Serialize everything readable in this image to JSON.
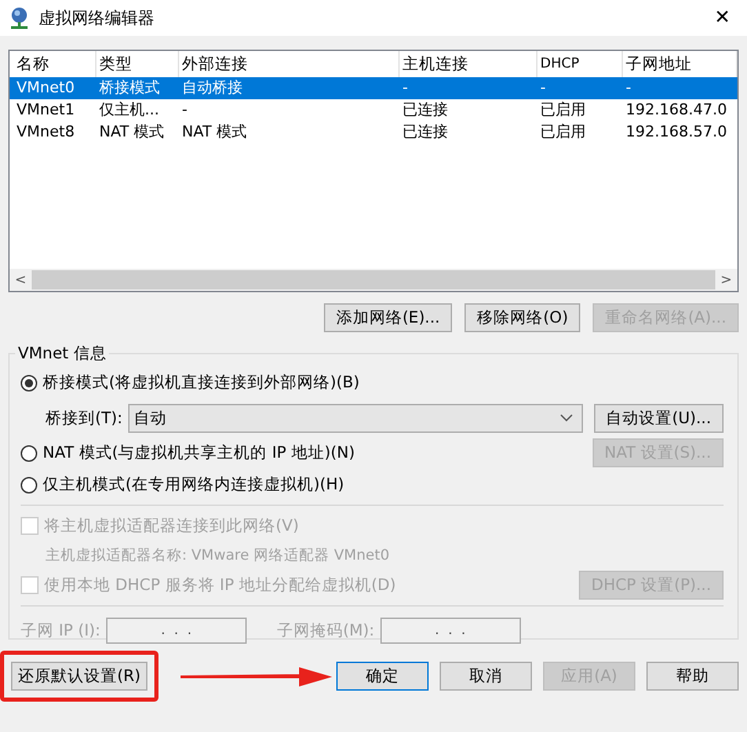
{
  "window": {
    "title": "虚拟网络编辑器",
    "close": "✕"
  },
  "table": {
    "columns": [
      "名称",
      "类型",
      "外部连接",
      "主机连接",
      "DHCP",
      "子网地址"
    ],
    "rows": [
      {
        "cells": [
          "VMnet0",
          "桥接模式",
          "自动桥接",
          "-",
          "-",
          "-"
        ],
        "selected": true
      },
      {
        "cells": [
          "VMnet1",
          "仅主机...",
          "-",
          "已连接",
          "已启用",
          "192.168.47.0"
        ],
        "selected": false
      },
      {
        "cells": [
          "VMnet8",
          "NAT 模式",
          "NAT 模式",
          "已连接",
          "已启用",
          "192.168.57.0"
        ],
        "selected": false
      }
    ],
    "scroll_left": "<",
    "scroll_right": ">"
  },
  "network_buttons": [
    {
      "label": "添加网络(E)...",
      "disabled": false
    },
    {
      "label": "移除网络(O)",
      "disabled": false
    },
    {
      "label": "重命名网络(A)...",
      "disabled": true
    }
  ],
  "vmnet_info": {
    "title": "VMnet 信息",
    "modes": [
      {
        "kind": "bridged",
        "label": "桥接模式(将虚拟机直接连接到外部网络)(B)",
        "selected": true
      },
      {
        "kind": "nat",
        "label": "NAT 模式(与虚拟机共享主机的 IP 地址)(N)",
        "selected": false,
        "button": {
          "label": "NAT 设置(S)...",
          "disabled": true
        }
      },
      {
        "kind": "hostonly",
        "label": "仅主机模式(在专用网络内连接虚拟机)(H)",
        "selected": false
      }
    ],
    "bridge_to": {
      "label": "桥接到(T):",
      "value": "自动",
      "button": {
        "label": "自动设置(U)...",
        "disabled": false
      }
    },
    "options": [
      {
        "label": "将主机虚拟适配器连接到此网络(V)",
        "checked": false,
        "disabled": true,
        "note": "主机虚拟适配器名称: VMware 网络适配器 VMnet0"
      },
      {
        "label": "使用本地 DHCP 服务将 IP 地址分配给虚拟机(D)",
        "checked": false,
        "disabled": true,
        "button": {
          "label": "DHCP 设置(P)...",
          "disabled": true
        }
      }
    ],
    "subnet": [
      {
        "label": "子网 IP (I):",
        "value": " .  .  . "
      },
      {
        "label": "子网掩码(M):",
        "value": " .  .  . "
      }
    ]
  },
  "restore_button": {
    "label": "还原默认设置(R)",
    "highlighted": true
  },
  "dialog_buttons": [
    {
      "label": "确定",
      "default": true,
      "disabled": false
    },
    {
      "label": "取消",
      "default": false,
      "disabled": false
    },
    {
      "label": "应用(A)",
      "default": false,
      "disabled": true
    },
    {
      "label": "帮助",
      "default": false,
      "disabled": false
    }
  ]
}
